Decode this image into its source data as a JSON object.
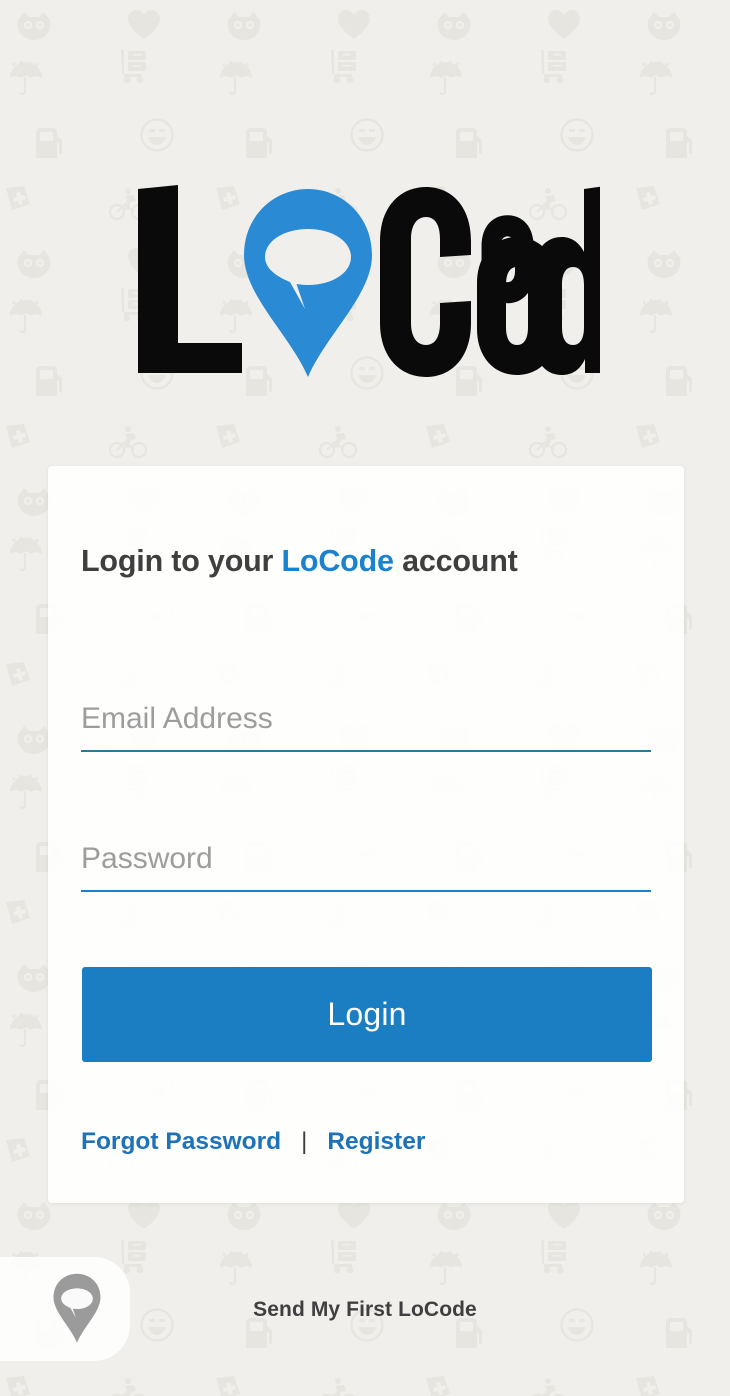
{
  "app": {
    "brand_name": "LoCode",
    "brand_color": "#1b82cd",
    "background_color": "#f1efeb"
  },
  "logo": {
    "text_before_pin": "L",
    "pin_icon": "map-pin-speech-bubble-icon",
    "text_after_pin": "Code",
    "pin_color": "#2a8ad4",
    "text_color": "#0a0a0a"
  },
  "card": {
    "title_prefix": "Login to your ",
    "title_brand": "LoCode",
    "title_suffix": " account",
    "email": {
      "placeholder": "Email Address",
      "value": "",
      "underline_color": "#2a7a9c"
    },
    "password": {
      "placeholder": "Password",
      "value": "",
      "underline_color": "#2080c8"
    },
    "login_button_label": "Login",
    "login_button_color": "#1b7dc2",
    "forgot_password_label": "Forgot Password",
    "link_separator": "|",
    "register_label": "Register",
    "link_color": "#1d72b8"
  },
  "bottom_bar": {
    "pin_icon": "map-pin-speech-bubble-icon",
    "pin_color": "#9b9b9b",
    "label": "Send My First LoCode"
  },
  "background_pattern": {
    "icon_color": "#e8e6e0",
    "icons": [
      "owl-face-icon",
      "heart-icon",
      "umbrella-icon",
      "hand-truck-icon",
      "gas-pump-icon",
      "smiley-face-icon",
      "first-aid-kit-icon",
      "cyclist-icon"
    ]
  }
}
